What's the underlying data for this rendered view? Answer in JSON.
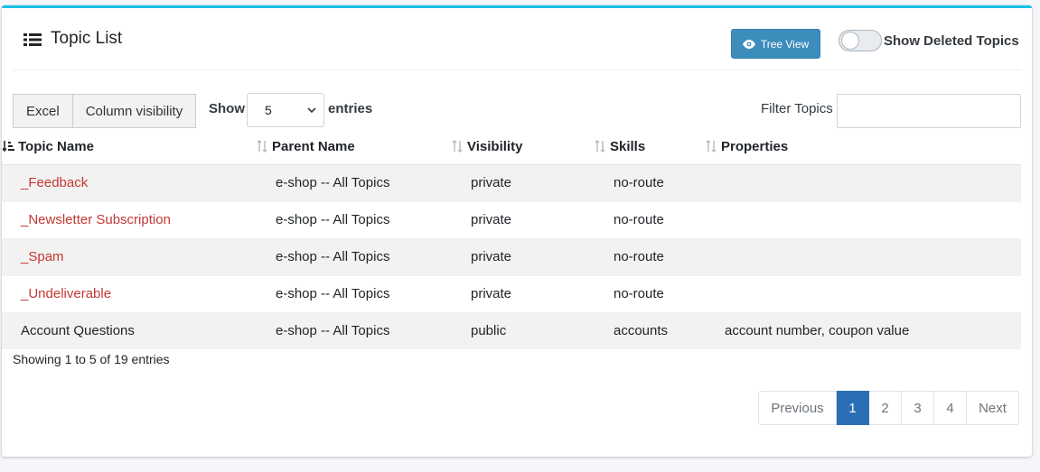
{
  "header": {
    "title": "Topic List",
    "tree_view_label": "Tree View",
    "show_deleted_label": "Show Deleted Topics",
    "show_deleted_on": false
  },
  "toolbar": {
    "excel_label": "Excel",
    "column_visibility_label": "Column visibility",
    "show_label": "Show",
    "page_length": "5",
    "entries_label": "entries",
    "filter_label": "Filter Topics",
    "filter_value": ""
  },
  "table": {
    "columns": [
      "Topic Name",
      "Parent Name",
      "Visibility",
      "Skills",
      "Properties"
    ],
    "rows": [
      {
        "name": "_Feedback",
        "parent": "e-shop -- All Topics",
        "visibility": "private",
        "skills": "no-route",
        "properties": "",
        "link": true
      },
      {
        "name": "_Newsletter Subscription",
        "parent": "e-shop -- All Topics",
        "visibility": "private",
        "skills": "no-route",
        "properties": "",
        "link": true
      },
      {
        "name": "_Spam",
        "parent": "e-shop -- All Topics",
        "visibility": "private",
        "skills": "no-route",
        "properties": "",
        "link": true
      },
      {
        "name": "_Undeliverable",
        "parent": "e-shop -- All Topics",
        "visibility": "private",
        "skills": "no-route",
        "properties": "",
        "link": true
      },
      {
        "name": "Account Questions",
        "parent": "e-shop -- All Topics",
        "visibility": "public",
        "skills": "accounts",
        "properties": "account number, coupon value",
        "link": false
      }
    ]
  },
  "footer": {
    "info": "Showing 1 to 5 of 19 entries",
    "previous_label": "Previous",
    "pages": [
      "1",
      "2",
      "3",
      "4"
    ],
    "active_page": "1",
    "next_label": "Next"
  },
  "colors": {
    "accent_top": "#17c1e8",
    "button_primary": "#3c8dbc",
    "link": "#c23934",
    "active_page": "#2a6fb5"
  },
  "icons": [
    "list-icon",
    "eye-icon",
    "chevron-down-icon",
    "sort-asc-icon",
    "sort-both-icon"
  ]
}
